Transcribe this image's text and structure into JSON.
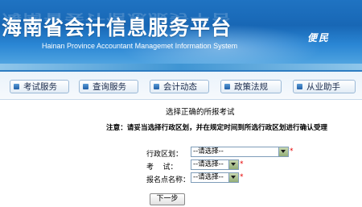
{
  "header": {
    "title": "海南省会计信息服务平台",
    "subtitle": "Hainan Province Accountant Managemet Information System",
    "slogan": "便民"
  },
  "nav": {
    "items": [
      {
        "label": "考试服务"
      },
      {
        "label": "查询服务"
      },
      {
        "label": "会计动态"
      },
      {
        "label": "政策法规"
      },
      {
        "label": "从业助手"
      }
    ]
  },
  "main": {
    "heading": "选择正确的所报考试",
    "note": "注意：请妥当选择行政区划，并在规定时间到所选行政区划进行确认受理",
    "form": {
      "region_label": "行政区划：",
      "region_value": "--请选择--",
      "exam_label": "考    试：",
      "exam_value": "--请选择--",
      "site_label": "报名点名称：",
      "site_value": "--请选择--",
      "required_mark": "*"
    },
    "next_label": "下一步"
  },
  "colors": {
    "header_blue": "#1867b5",
    "required_red": "#e60000"
  }
}
